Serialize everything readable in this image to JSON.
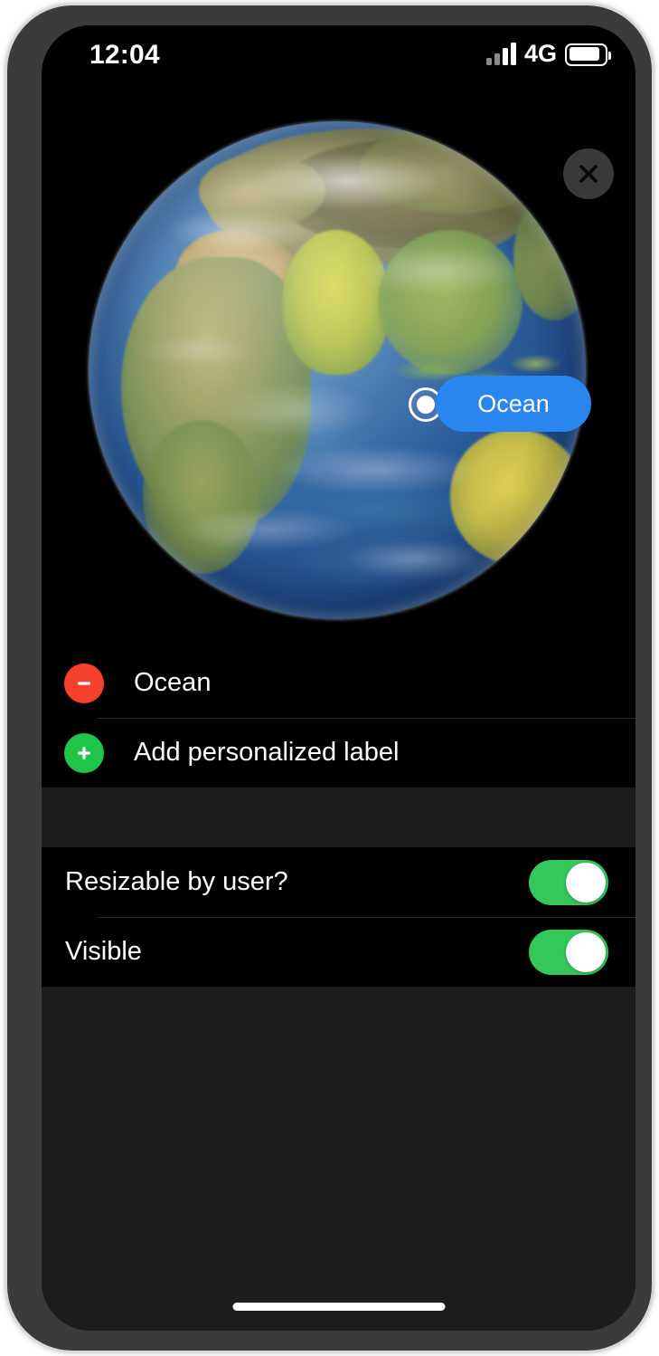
{
  "status_bar": {
    "time": "12:04",
    "network_label": "4G",
    "signal_icon": "signal-bars-icon",
    "battery_icon": "battery-icon"
  },
  "globe": {
    "close_icon": "close-x-icon",
    "marker": {
      "icon": "location-dot-icon",
      "label": "Ocean"
    }
  },
  "labels_section": {
    "rows": [
      {
        "icon": "remove-circle-icon",
        "label": "Ocean"
      },
      {
        "icon": "add-circle-icon",
        "label": "Add personalized label"
      }
    ]
  },
  "settings_section": {
    "rows": [
      {
        "label": "Resizable by user?",
        "toggle_state": "on"
      },
      {
        "label": "Visible",
        "toggle_state": "on"
      }
    ]
  },
  "colors": {
    "accent_blue": "#2a86ef",
    "toggle_green": "#34c759",
    "add_green": "#21c44a",
    "remove_red": "#f5402c",
    "row_background": "#000000",
    "group_gap": "#1c1c1e"
  },
  "home_indicator": "home-indicator"
}
